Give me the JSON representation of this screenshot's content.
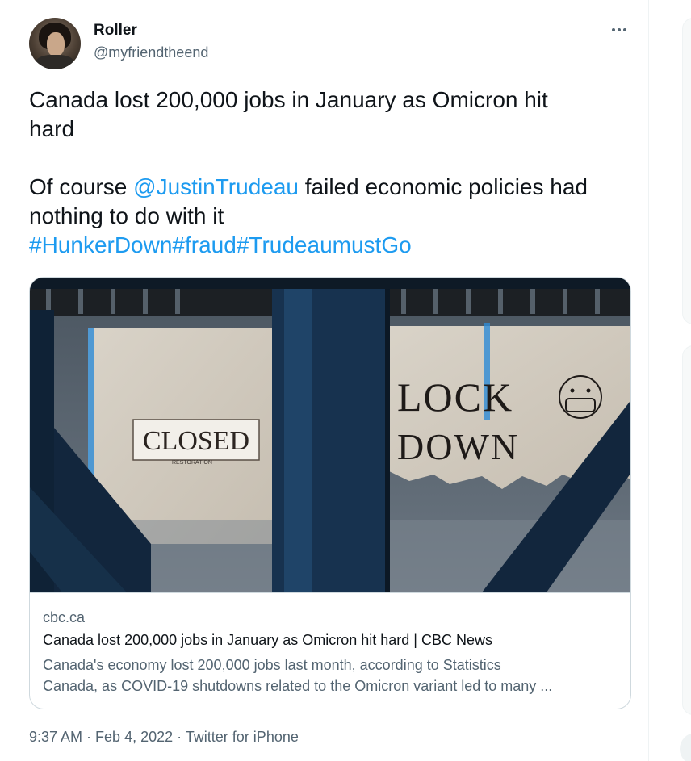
{
  "author": {
    "name": "Roller",
    "handle": "@myfriendtheend"
  },
  "tweet": {
    "line1": "Canada lost 200,000 jobs in January as Omicron hit",
    "line2": "hard",
    "line3_prefix": "Of course ",
    "mention": "@JustinTrudeau",
    "line3_suffix": " failed economic policies had",
    "line4": "nothing to do with it",
    "hashtags": [
      "#HunkerDown",
      "#fraud",
      "#TrudeaumustGo"
    ]
  },
  "card": {
    "image_signs": {
      "left": "CLOSED",
      "left_small": "RESTORATION",
      "right_top": "LOCK",
      "right_bottom": "DOWN"
    },
    "domain": "cbc.ca",
    "title": "Canada lost 200,000 jobs in January as Omicron hit hard | CBC News",
    "description_line1": "Canada's economy lost 200,000 jobs last month, according to Statistics",
    "description_line2": "Canada, as COVID-19 shutdowns related to the Omicron variant led to many ..."
  },
  "meta": {
    "time": "9:37 AM",
    "sep1": " · ",
    "date": "Feb 4, 2022",
    "sep2": " · ",
    "source": "Twitter for iPhone"
  },
  "icons": {
    "more": "more-horizontal-icon"
  },
  "colors": {
    "link": "#1d9bf0",
    "secondary_text": "#536471",
    "primary_text": "#0f1419",
    "border": "#cfd9de"
  }
}
